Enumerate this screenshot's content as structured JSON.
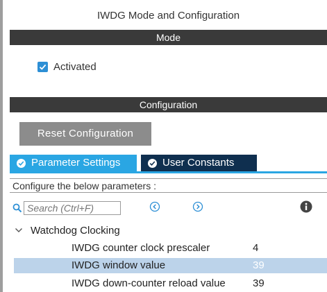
{
  "window": {
    "title": "IWDG Mode and Configuration"
  },
  "mode_section": {
    "header": "Mode",
    "activated": {
      "label": "Activated",
      "checked": true
    }
  },
  "config_section": {
    "header": "Configuration",
    "reset_button": "Reset Configuration",
    "tabs": [
      {
        "label": "Parameter Settings",
        "active": true
      },
      {
        "label": "User Constants",
        "active": false
      }
    ],
    "configure_text": "Configure the below parameters :",
    "search": {
      "placeholder": "Search (Ctrl+F)",
      "value": ""
    },
    "group": {
      "label": "Watchdog Clocking",
      "params": [
        {
          "name": "IWDG counter clock prescaler",
          "value": "4"
        },
        {
          "name": "IWDG window value",
          "value": "39",
          "selected": true
        },
        {
          "name": "IWDG down-counter reload value",
          "value": "39"
        }
      ]
    }
  },
  "colors": {
    "header_bar": "#3a3a3a",
    "checkbox": "#2d8fd5",
    "tab_active": "#2aa6e3",
    "tab_inactive": "#0f2f4f",
    "reset_button": "#8c8c8c",
    "selected_row": "#bcd3ea"
  },
  "icons": {
    "checkbox": "check-icon",
    "tab": "check-circle-icon",
    "search": "search-icon",
    "prev": "chevron-left-circle-icon",
    "next": "chevron-right-circle-icon",
    "info": "info-icon",
    "expander": "chevron-down-icon"
  }
}
